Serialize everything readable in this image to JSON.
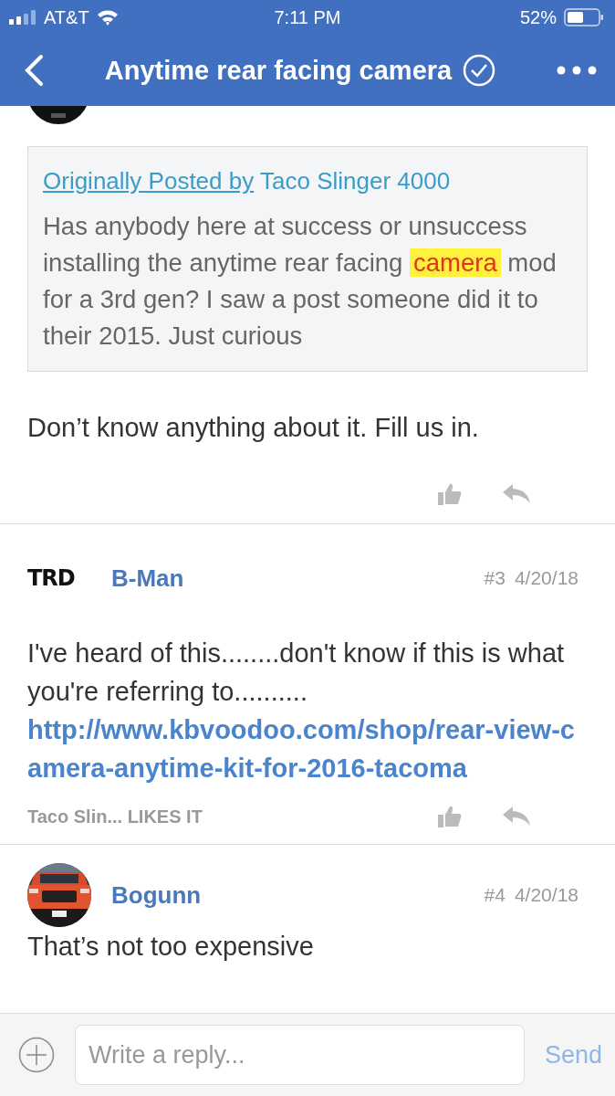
{
  "status_bar": {
    "carrier": "AT&T",
    "time": "7:11 PM",
    "battery": "52%"
  },
  "nav": {
    "title": "Anytime rear facing camera"
  },
  "posts": [
    {
      "kind": "quoted",
      "quote": {
        "link": "Originally Posted by",
        "author": "Taco Slinger 4000",
        "before": "Has anybody here at success or unsuccess installing the anytime rear facing ",
        "highlight": "camera",
        "after": " mod for a 3rd gen? I saw a post someone did it to their 2015. Just curious"
      },
      "body": "Don’t know anything about it. Fill us in."
    },
    {
      "kind": "full",
      "avatar": {
        "kind": "logo",
        "text": "TRD"
      },
      "author": "B-Man",
      "number": "#3",
      "date": "4/20/18",
      "body": "I've heard of this........don't know if this is what you're referring to..........",
      "link": "http://www.kbvoodoo.com/shop/rear-view-camera-anytime-kit-for-2016-tacoma",
      "likes": "Taco Slin... LIKES IT"
    },
    {
      "kind": "partial",
      "author": "Bogunn",
      "number": "#4",
      "date": "4/20/18",
      "body": "That’s not too expensive"
    }
  ],
  "reply_bar": {
    "placeholder": "Write a reply...",
    "send": "Send"
  }
}
